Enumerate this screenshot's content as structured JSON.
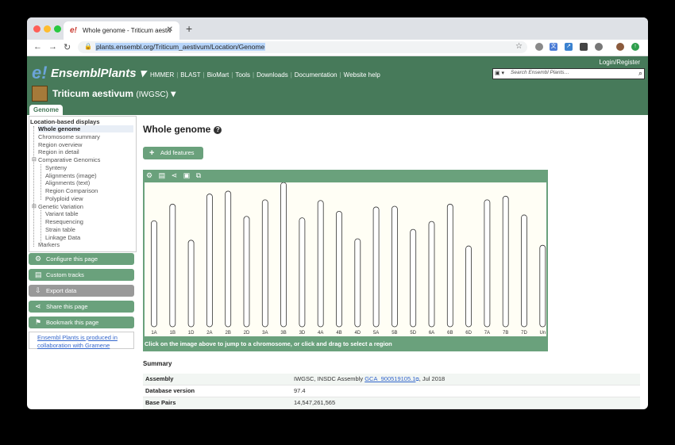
{
  "browser": {
    "tab_title": "Whole genome - Triticum aestiv",
    "tab_favicon": "e!",
    "url": "plants.ensembl.org/Triticum_aestivum/Location/Genome"
  },
  "header": {
    "login": "Login/Register",
    "logo_e": "e!",
    "logo_text": "EnsemblPlants",
    "nav": [
      "HMMER",
      "BLAST",
      "BioMart",
      "Tools",
      "Downloads",
      "Documentation",
      "Website help"
    ],
    "search_placeholder": "Search Ensembl Plants…",
    "species": "Triticum aestivum",
    "assembly": "(IWGSC)",
    "tab": "Genome"
  },
  "sidebar": {
    "heading": "Location-based displays",
    "items": [
      {
        "label": "Whole genome",
        "level": 1,
        "active": true
      },
      {
        "label": "Chromosome summary",
        "level": 1
      },
      {
        "label": "Region overview",
        "level": 1
      },
      {
        "label": "Region in detail",
        "level": 1
      },
      {
        "label": "Comparative Genomics",
        "level": 1
      },
      {
        "label": "Synteny",
        "level": 2
      },
      {
        "label": "Alignments (image)",
        "level": 2
      },
      {
        "label": "Alignments (text)",
        "level": 2
      },
      {
        "label": "Region Comparison",
        "level": 2
      },
      {
        "label": "Polyploid view",
        "level": 2
      },
      {
        "label": "Genetic Variation",
        "level": 1
      },
      {
        "label": "Variant table",
        "level": 2
      },
      {
        "label": "Resequencing",
        "level": 2
      },
      {
        "label": "Strain table",
        "level": 2
      },
      {
        "label": "Linkage Data",
        "level": 2
      },
      {
        "label": "Markers",
        "level": 1
      }
    ],
    "buttons": [
      {
        "label": "Configure this page",
        "icon": "gear-icon"
      },
      {
        "label": "Custom tracks",
        "icon": "tracks-icon"
      },
      {
        "label": "Export data",
        "icon": "export-icon"
      },
      {
        "label": "Share this page",
        "icon": "share-icon"
      },
      {
        "label": "Bookmark this page",
        "icon": "bookmark-icon"
      }
    ],
    "note": "Ensembl Plants is produced in collaboration with Gramene"
  },
  "main": {
    "title": "Whole genome",
    "add_features": "Add features",
    "panel_footer": "Click on the image above to jump to a chromosome, or click and drag to select a region",
    "summary_title": "Summary",
    "summary": [
      {
        "key": "Assembly",
        "value": "IWGSC, INSDC Assembly ",
        "link": "GCA_900519105.1",
        "suffix": ", Jul 2018"
      },
      {
        "key": "Database version",
        "value": "97.4"
      },
      {
        "key": "Base Pairs",
        "value": "14,547,261,565"
      }
    ]
  },
  "chromosomes": [
    {
      "name": "1A",
      "length": 0.735
    },
    {
      "name": "1B",
      "length": 0.85
    },
    {
      "name": "1D",
      "length": 0.6
    },
    {
      "name": "2A",
      "length": 0.92
    },
    {
      "name": "2B",
      "length": 0.94
    },
    {
      "name": "2D",
      "length": 0.765
    },
    {
      "name": "3A",
      "length": 0.88
    },
    {
      "name": "3B",
      "length": 1.0
    },
    {
      "name": "3D",
      "length": 0.755
    },
    {
      "name": "4A",
      "length": 0.875
    },
    {
      "name": "4B",
      "length": 0.8
    },
    {
      "name": "4D",
      "length": 0.61
    },
    {
      "name": "5A",
      "length": 0.83
    },
    {
      "name": "5B",
      "length": 0.835
    },
    {
      "name": "5D",
      "length": 0.675
    },
    {
      "name": "6A",
      "length": 0.73
    },
    {
      "name": "6B",
      "length": 0.85
    },
    {
      "name": "6D",
      "length": 0.56
    },
    {
      "name": "7A",
      "length": 0.88
    },
    {
      "name": "7B",
      "length": 0.905
    },
    {
      "name": "7D",
      "length": 0.775
    },
    {
      "name": "Un",
      "length": 0.565
    }
  ]
}
